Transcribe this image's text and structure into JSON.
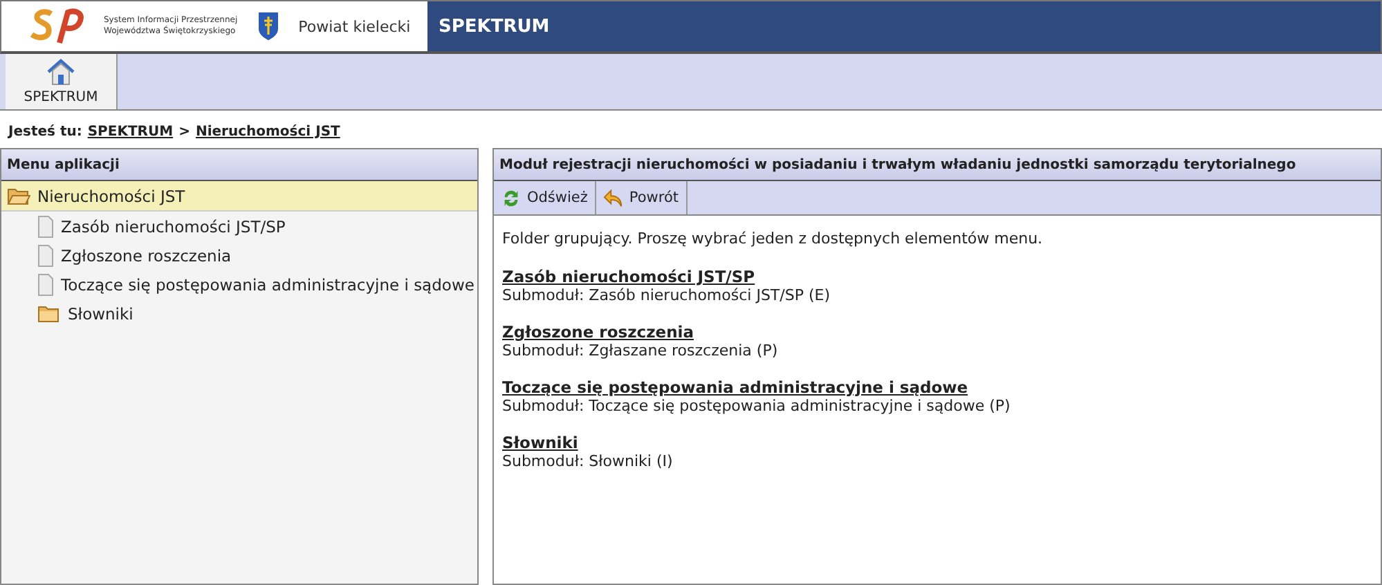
{
  "header": {
    "logo_caption": [
      "System Informacji Przestrzennej",
      "Województwa Świętokrzyskiego"
    ],
    "district": "Powiat kielecki",
    "app_title": "SPEKTRUM"
  },
  "tabs": [
    {
      "label": "SPEKTRUM",
      "selected": true
    }
  ],
  "breadcrumb": {
    "prefix": "Jesteś tu:",
    "links": [
      "SPEKTRUM",
      "Nieruchomości JST"
    ],
    "separator": ">"
  },
  "sidebar": {
    "title": "Menu aplikacji",
    "items": [
      {
        "label": "Nieruchomości JST",
        "kind": "folder",
        "expanded": true,
        "selected": true,
        "children": [
          {
            "label": "Zasób nieruchomości JST/SP",
            "kind": "page",
            "selected": false
          },
          {
            "label": "Zgłoszone roszczenia",
            "kind": "page",
            "selected": false
          },
          {
            "label": "Toczące się postępowania administracyjne i sądowe",
            "kind": "page",
            "selected": false
          },
          {
            "label": "Słowniki",
            "kind": "folder",
            "expanded": false,
            "selected": false
          }
        ]
      }
    ]
  },
  "main": {
    "title": "Moduł rejestracji nieruchomości w posiadaniu i trwałym władaniu jednostki samorządu terytorialnego",
    "toolbar": [
      {
        "label": "Odśwież",
        "kind": "refresh"
      },
      {
        "label": "Powrót",
        "kind": "back"
      }
    ],
    "intro": "Folder grupujący. Proszę wybrać jeden z dostępnych elementów menu.",
    "modules": [
      {
        "title": "Zasób nieruchomości JST/SP",
        "subtitle": "Submoduł: Zasób nieruchomości JST/SP (E)"
      },
      {
        "title": "Zgłoszone roszczenia",
        "subtitle": "Submoduł: Zgłaszane roszczenia (P)"
      },
      {
        "title": "Toczące się postępowania administracyjne i sądowe",
        "subtitle": "Submoduł: Toczące się postępowania administracyjne i sądowe (P)"
      },
      {
        "title": "Słowniki",
        "subtitle": "Submoduł: Słowniki (I)"
      }
    ]
  }
}
